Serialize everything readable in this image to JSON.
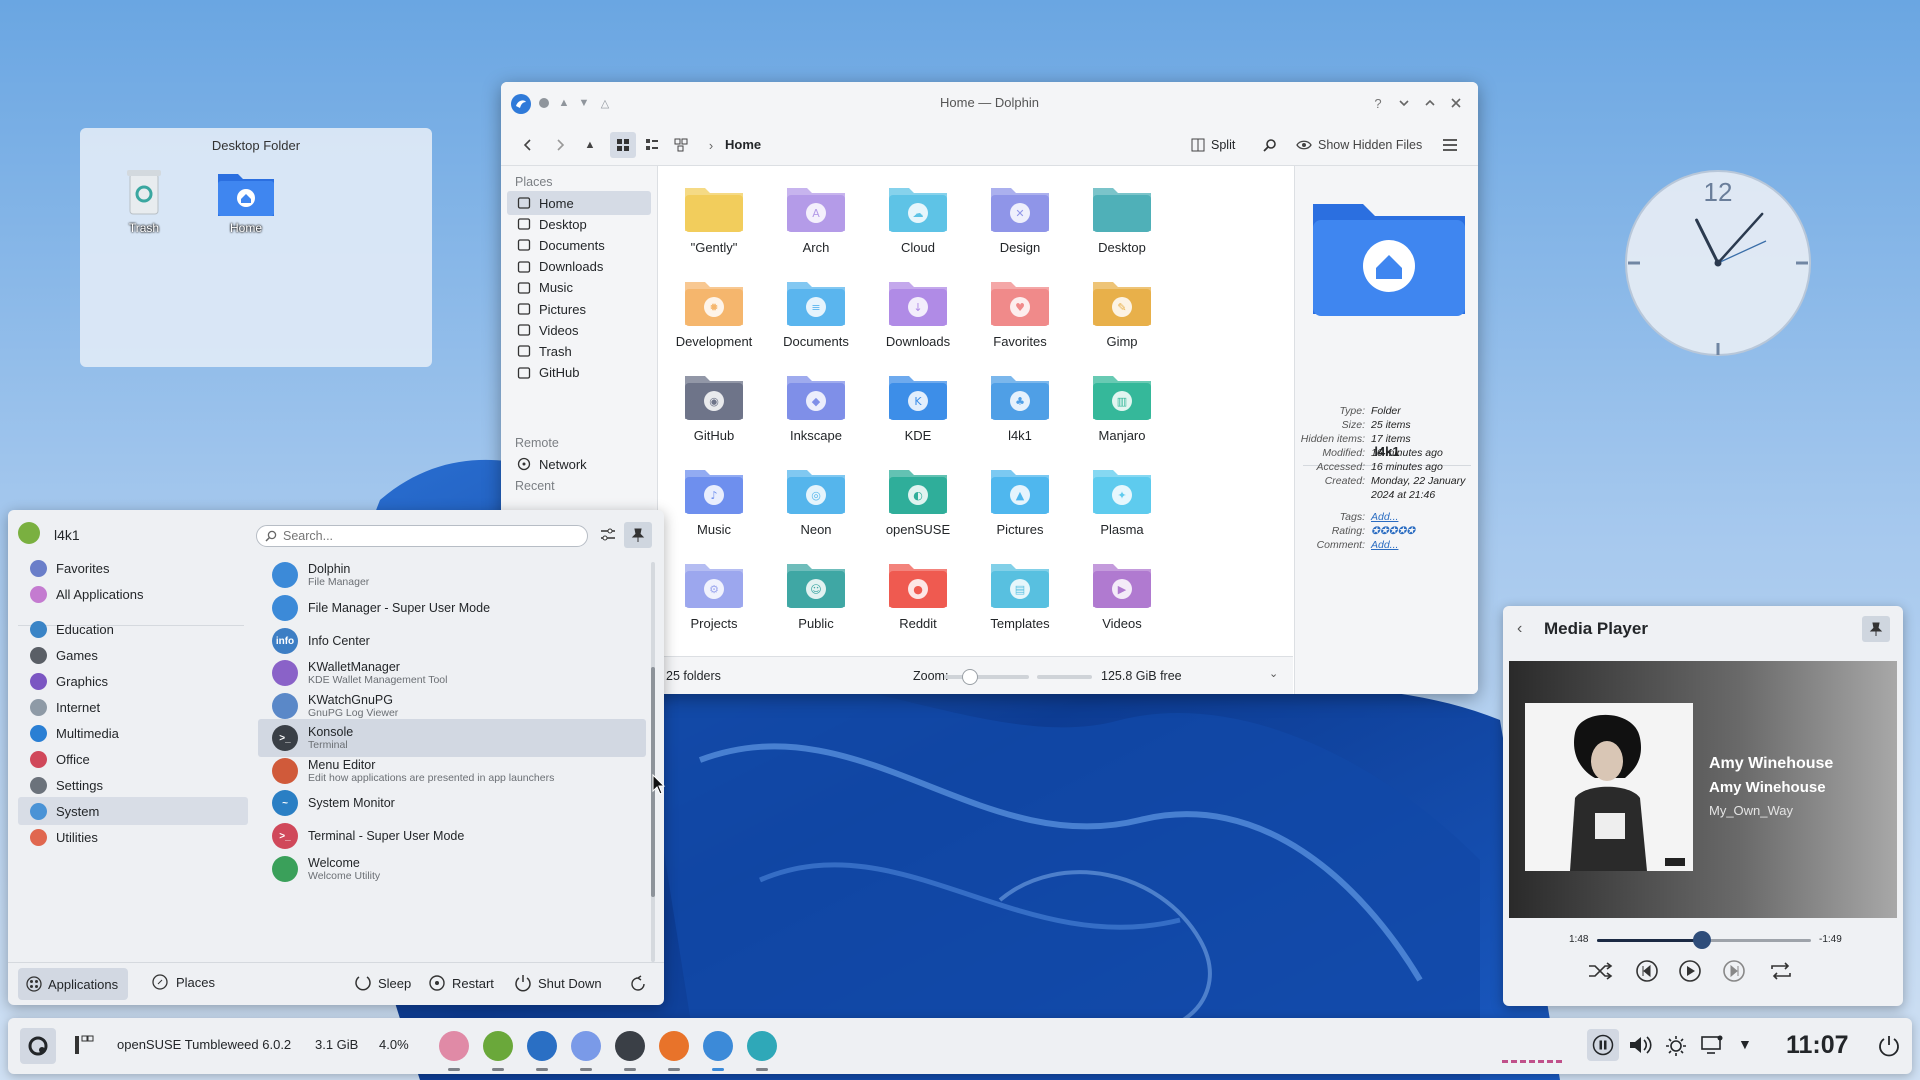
{
  "desktop_folder": {
    "title": "Desktop Folder",
    "icons": [
      {
        "label": "Trash",
        "icon": "trash-icon"
      },
      {
        "label": "Home",
        "icon": "home-folder-icon"
      }
    ]
  },
  "dolphin": {
    "title": "Home — Dolphin",
    "breadcrumb": "Home",
    "toolbar": {
      "split": "Split",
      "show_hidden": "Show Hidden Files"
    },
    "places": {
      "places_header": "Places",
      "items": [
        {
          "label": "Home",
          "icon": "home-icon"
        },
        {
          "label": "Desktop",
          "icon": "desktop-icon"
        },
        {
          "label": "Documents",
          "icon": "documents-icon"
        },
        {
          "label": "Downloads",
          "icon": "downloads-icon"
        },
        {
          "label": "Music",
          "icon": "music-icon"
        },
        {
          "label": "Pictures",
          "icon": "pictures-icon"
        },
        {
          "label": "Videos",
          "icon": "videos-icon"
        },
        {
          "label": "Trash",
          "icon": "trash-icon"
        },
        {
          "label": "GitHub",
          "icon": "github-icon"
        }
      ],
      "remote_header": "Remote",
      "remote_items": [
        {
          "label": "Network",
          "icon": "network-icon"
        }
      ],
      "recent_header": "Recent"
    },
    "folders": [
      {
        "label": "\"Gently\"",
        "color": "#f2cd5c",
        "glyph": ""
      },
      {
        "label": "Arch",
        "color": "#b49be8",
        "glyph": "A"
      },
      {
        "label": "Cloud",
        "color": "#5ec3e6",
        "glyph": "☁"
      },
      {
        "label": "Design",
        "color": "#8f95e8",
        "glyph": "✕"
      },
      {
        "label": "Desktop",
        "color": "#4fb0b8",
        "glyph": ""
      },
      {
        "label": "Development",
        "color": "#f5b66d",
        "glyph": "✹"
      },
      {
        "label": "Documents",
        "color": "#5ab5ee",
        "glyph": "≡"
      },
      {
        "label": "Downloads",
        "color": "#b08be6",
        "glyph": "↓"
      },
      {
        "label": "Favorites",
        "color": "#f08a8a",
        "glyph": "♥"
      },
      {
        "label": "Gimp",
        "color": "#e8b04a",
        "glyph": "✎"
      },
      {
        "label": "GitHub",
        "color": "#6e7489",
        "glyph": "◉"
      },
      {
        "label": "Inkscape",
        "color": "#7f8fe8",
        "glyph": "◆"
      },
      {
        "label": "KDE",
        "color": "#3d8ee8",
        "glyph": "K"
      },
      {
        "label": "l4k1",
        "color": "#4f9fe6",
        "glyph": "♣"
      },
      {
        "label": "Manjaro",
        "color": "#35b89a",
        "glyph": "▥"
      },
      {
        "label": "Music",
        "color": "#6e8fee",
        "glyph": "♪"
      },
      {
        "label": "Neon",
        "color": "#55b5ec",
        "glyph": "◎"
      },
      {
        "label": "openSUSE",
        "color": "#2fae9a",
        "glyph": "◐"
      },
      {
        "label": "Pictures",
        "color": "#4fb7ee",
        "glyph": "▲"
      },
      {
        "label": "Plasma",
        "color": "#5ecbee",
        "glyph": "✦"
      },
      {
        "label": "Projects",
        "color": "#9ca7ee",
        "glyph": "⚙"
      },
      {
        "label": "Public",
        "color": "#3fa7a4",
        "glyph": "☺"
      },
      {
        "label": "Reddit",
        "color": "#ef5a50",
        "glyph": "●"
      },
      {
        "label": "Templates",
        "color": "#58c0e0",
        "glyph": "▤"
      },
      {
        "label": "Videos",
        "color": "#b07ad0",
        "glyph": "▶"
      }
    ],
    "status": {
      "folders": "25 folders",
      "zoom_label": "Zoom:",
      "zoom_level": 0.3,
      "free": "125.8 GiB free"
    },
    "info_panel": {
      "name": "l4k1",
      "rows": [
        {
          "k": "Type:",
          "v": "Folder"
        },
        {
          "k": "Size:",
          "v": "25 items"
        },
        {
          "k": "Hidden items:",
          "v": "17 items"
        },
        {
          "k": "Modified:",
          "v": "16 minutes ago"
        },
        {
          "k": "Accessed:",
          "v": "16 minutes ago"
        },
        {
          "k": "Created:",
          "v": "Monday, 22 January 2024 at 21:46"
        },
        {
          "k": "Tags:",
          "v": "Add..."
        },
        {
          "k": "Rating:",
          "v": ""
        },
        {
          "k": "Comment:",
          "v": "Add..."
        }
      ]
    }
  },
  "clock": {
    "hour": 11,
    "minute": 7,
    "numeral": "12"
  },
  "media_player": {
    "title": "Media Player",
    "track": "Amy Winehouse",
    "artist": "Amy Winehouse",
    "album": "My_Own_Way",
    "elapsed": "1:48",
    "remaining": "-1:49",
    "progress": 0.49
  },
  "launcher": {
    "user": "l4k1",
    "search_placeholder": "Search...",
    "categories": [
      {
        "label": "Favorites",
        "color": "#6a7ec9"
      },
      {
        "label": "All Applications",
        "color": "#c47bd0"
      },
      {
        "label": "Education",
        "color": "#3a84c6"
      },
      {
        "label": "Games",
        "color": "#5a5f66"
      },
      {
        "label": "Graphics",
        "color": "#7b56c2"
      },
      {
        "label": "Internet",
        "color": "#8e9aa6"
      },
      {
        "label": "Multimedia",
        "color": "#2a7fd4"
      },
      {
        "label": "Office",
        "color": "#d0485a"
      },
      {
        "label": "Settings",
        "color": "#6b727b"
      },
      {
        "label": "System",
        "color": "#4a93d6"
      },
      {
        "label": "Utilities",
        "color": "#e0674f"
      }
    ],
    "apps": [
      {
        "name": "Dolphin",
        "sub": "File Manager",
        "color": "#3c8ad8",
        "glyph": ""
      },
      {
        "name": "File Manager - Super User Mode",
        "sub": "",
        "color": "#3c8ad8",
        "glyph": ""
      },
      {
        "name": "Info Center",
        "sub": "",
        "color": "#3d7ec4",
        "glyph": "info"
      },
      {
        "name": "KWalletManager",
        "sub": "KDE Wallet Management Tool",
        "color": "#8a62c8",
        "glyph": ""
      },
      {
        "name": "KWatchGnuPG",
        "sub": "GnuPG Log Viewer",
        "color": "#5a88c8",
        "glyph": ""
      },
      {
        "name": "Konsole",
        "sub": "Terminal",
        "color": "#3a3f46",
        "glyph": ">_"
      },
      {
        "name": "Menu Editor",
        "sub": "Edit how applications are presented in app launchers",
        "color": "#d05a3a",
        "glyph": ""
      },
      {
        "name": "System Monitor",
        "sub": "",
        "color": "#2a7fc4",
        "glyph": "~"
      },
      {
        "name": "Terminal - Super User Mode",
        "sub": "",
        "color": "#d0485a",
        "glyph": ">_"
      },
      {
        "name": "Welcome",
        "sub": "Welcome Utility",
        "color": "#3aa05a",
        "glyph": ""
      }
    ],
    "footer": {
      "applications": "Applications",
      "places": "Places",
      "sleep": "Sleep",
      "restart": "Restart",
      "shutdown": "Shut Down"
    }
  },
  "taskbar": {
    "os_label": "openSUSE Tumbleweed 6.0.2",
    "memory": "3.1 GiB",
    "cpu": "4.0%",
    "time": "11:07",
    "apps": [
      {
        "icon": "system-tray-app-icon",
        "color": "#e08aa6"
      },
      {
        "icon": "gecko-app-icon",
        "color": "#6aa83a"
      },
      {
        "icon": "system-monitor-app-icon",
        "color": "#2a6fc4"
      },
      {
        "icon": "discover-app-icon",
        "color": "#7a9ae8"
      },
      {
        "icon": "settings-app-icon",
        "color": "#3a3f46"
      },
      {
        "icon": "firefox-app-icon",
        "color": "#e8732a"
      },
      {
        "icon": "dolphin-app-icon",
        "color": "#3c8ad8"
      },
      {
        "icon": "disk-app-icon",
        "color": "#2fa8b8"
      }
    ]
  }
}
